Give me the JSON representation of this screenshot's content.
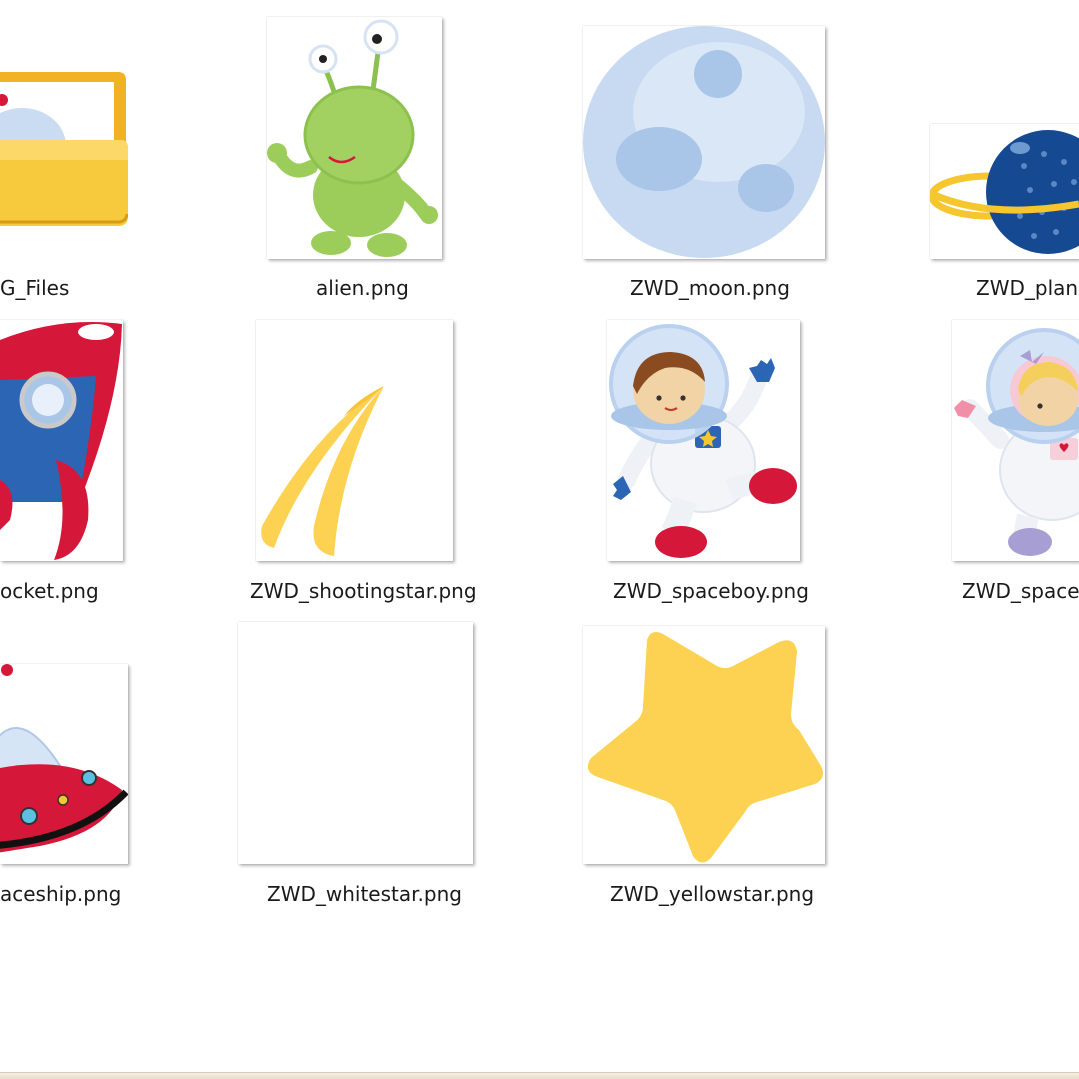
{
  "files": [
    {
      "name": "G_Files",
      "icon": "folder-icon"
    },
    {
      "name": "alien.png",
      "icon": "alien-icon"
    },
    {
      "name": "ZWD_moon.png",
      "icon": "moon-icon"
    },
    {
      "name": "ZWD_plane",
      "icon": "planet-icon"
    },
    {
      "name": "ocket.png",
      "icon": "rocket-icon"
    },
    {
      "name": "ZWD_shootingstar.png",
      "icon": "shooting-star-icon"
    },
    {
      "name": "ZWD_spaceboy.png",
      "icon": "spaceboy-icon"
    },
    {
      "name": "ZWD_spaceg",
      "icon": "spacegirl-icon"
    },
    {
      "name": "aceship.png",
      "icon": "spaceship-icon"
    },
    {
      "name": "ZWD_whitestar.png",
      "icon": "white-star-icon"
    },
    {
      "name": "ZWD_yellowstar.png",
      "icon": "yellow-star-icon"
    }
  ],
  "colors": {
    "folder": "#f5c230",
    "alien": "#9ccd5b",
    "moon": "#c7daf2",
    "planet": "#154a92",
    "rocket_red": "#d5173a",
    "rocket_blue": "#2c65b3",
    "star_yellow": "#fdd152"
  }
}
